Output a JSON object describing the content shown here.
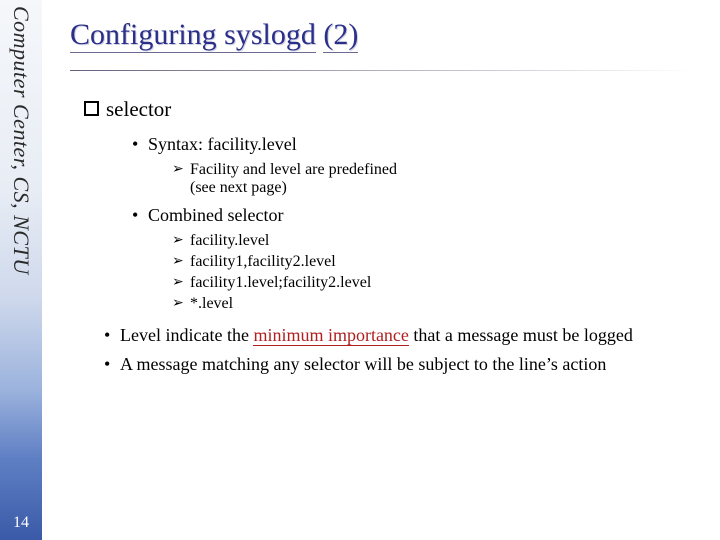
{
  "sidebar": {
    "text": "Computer Center, CS, NCTU",
    "page_number": "14"
  },
  "title": {
    "main": "Configuring syslogd",
    "suffix": "(2)"
  },
  "selector_heading": "selector",
  "bullets": {
    "syntax": "Syntax: facility.level",
    "syntax_sub1": "Facility and level are predefined",
    "syntax_sub2": "(see next page)",
    "combined_heading": "Combined selector",
    "combined_items": {
      "a": "facility.level",
      "b": "facility1,facility2.level",
      "c": "facility1.level;facility2.level",
      "d": "*.level"
    },
    "level_line_pre": "Level indicate the ",
    "level_line_key": "minimum importance",
    "level_line_post": " that a message must be logged",
    "match_line": "A message matching any selector will be subject to the line’s action"
  }
}
